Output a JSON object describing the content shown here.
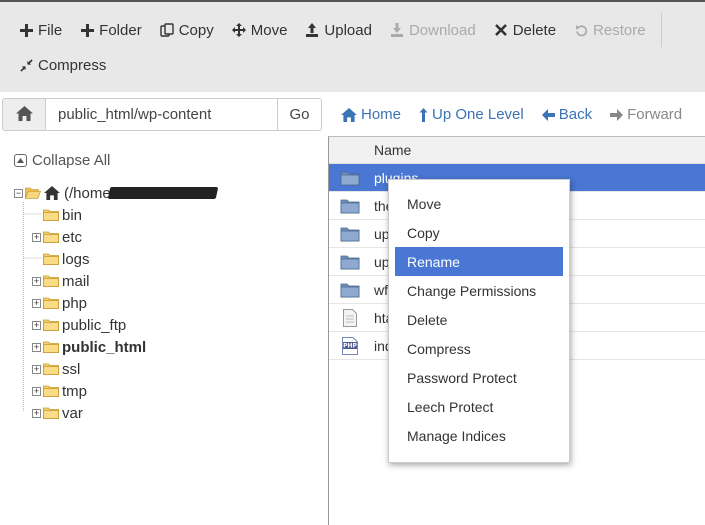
{
  "toolbar": {
    "row1": [
      {
        "label": "File",
        "icon": "plus-icon",
        "disabled": false
      },
      {
        "label": "Folder",
        "icon": "plus-icon",
        "disabled": false
      },
      {
        "label": "Copy",
        "icon": "copy-icon",
        "disabled": false
      },
      {
        "label": "Move",
        "icon": "move-icon",
        "disabled": false
      },
      {
        "label": "Upload",
        "icon": "upload-icon",
        "disabled": false
      },
      {
        "label": "Download",
        "icon": "download-icon",
        "disabled": true
      },
      {
        "label": "Delete",
        "icon": "delete-icon",
        "disabled": false
      },
      {
        "label": "Restore",
        "icon": "restore-icon",
        "disabled": true
      }
    ],
    "row2": [
      {
        "label": "Compress",
        "icon": "compress-icon",
        "disabled": false
      }
    ]
  },
  "pathbar": {
    "path": "public_html/wp-content",
    "go_label": "Go"
  },
  "nav": {
    "home": "Home",
    "up": "Up One Level",
    "back": "Back",
    "forward": "Forward"
  },
  "tree": {
    "collapse_label": "Collapse All",
    "root_label": "(/home/",
    "items": [
      {
        "label": "bin",
        "expandable": false,
        "bold": false
      },
      {
        "label": "etc",
        "expandable": true,
        "bold": false
      },
      {
        "label": "logs",
        "expandable": false,
        "bold": false
      },
      {
        "label": "mail",
        "expandable": true,
        "bold": false
      },
      {
        "label": "php",
        "expandable": true,
        "bold": false
      },
      {
        "label": "public_ftp",
        "expandable": true,
        "bold": false
      },
      {
        "label": "public_html",
        "expandable": true,
        "bold": true
      },
      {
        "label": "ssl",
        "expandable": true,
        "bold": false
      },
      {
        "label": "tmp",
        "expandable": true,
        "bold": false
      },
      {
        "label": "var",
        "expandable": true,
        "bold": false
      }
    ]
  },
  "files": {
    "column_name": "Name",
    "rows": [
      {
        "name": "plugins",
        "type": "folder",
        "selected": true
      },
      {
        "name": "the",
        "type": "folder",
        "selected": false
      },
      {
        "name": "up",
        "type": "folder",
        "selected": false
      },
      {
        "name": "up",
        "type": "folder",
        "selected": false
      },
      {
        "name": "wf",
        "type": "folder",
        "selected": false
      },
      {
        "name": "hta",
        "type": "text",
        "selected": false
      },
      {
        "name": "ind",
        "type": "php",
        "selected": false
      }
    ]
  },
  "context_menu": {
    "items": [
      {
        "label": "Move",
        "active": false
      },
      {
        "label": "Copy",
        "active": false
      },
      {
        "label": "Rename",
        "active": true
      },
      {
        "label": "Change Permissions",
        "active": false
      },
      {
        "label": "Delete",
        "active": false
      },
      {
        "label": "Compress",
        "active": false
      },
      {
        "label": "Password Protect",
        "active": false
      },
      {
        "label": "Leech Protect",
        "active": false
      },
      {
        "label": "Manage Indices",
        "active": false
      }
    ]
  },
  "colors": {
    "accent": "#4a77d4",
    "link": "#3c73b4",
    "toolbar_bg": "#e8e8e8"
  }
}
